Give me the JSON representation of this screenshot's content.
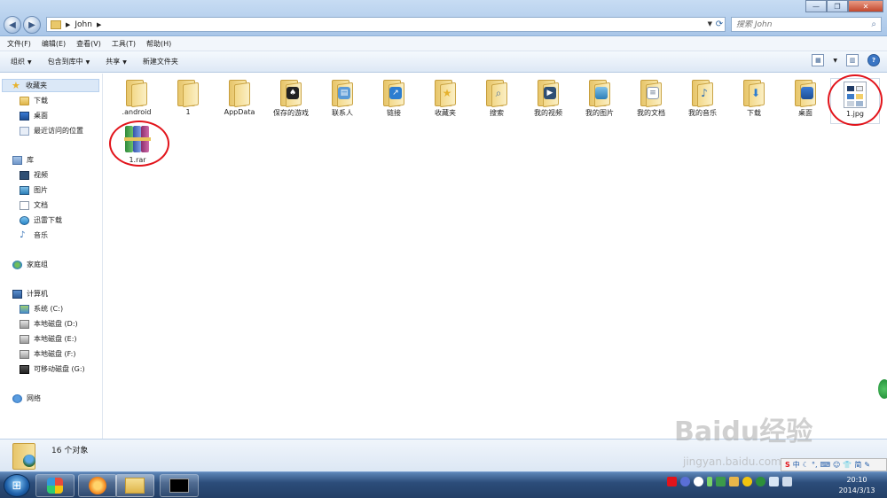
{
  "titlebar": {
    "breadcrumb": [
      "John"
    ],
    "search_placeholder": "搜索 John",
    "back_icon": "back-arrow-icon",
    "forward_icon": "forward-arrow-icon"
  },
  "menu": [
    "文件(F)",
    "编辑(E)",
    "查看(V)",
    "工具(T)",
    "帮助(H)"
  ],
  "toolbar": {
    "organize": "组织",
    "include_in_library": "包含到库中",
    "share": "共享",
    "new_folder": "新建文件夹"
  },
  "sidebar": {
    "favorites": {
      "label": "收藏夹",
      "items": [
        "下载",
        "桌面",
        "最近访问的位置"
      ]
    },
    "libraries": {
      "label": "库",
      "items": [
        "视频",
        "图片",
        "文档",
        "迅雷下载",
        "音乐"
      ]
    },
    "homegroup": "家庭组",
    "computer": {
      "label": "计算机",
      "items": [
        "系统 (C:)",
        "本地磁盘 (D:)",
        "本地磁盘 (E:)",
        "本地磁盘 (F:)",
        "可移动磁盘 (G:)"
      ]
    },
    "network": "网络"
  },
  "files": [
    {
      "name": ".android",
      "type": "folder"
    },
    {
      "name": "1",
      "type": "folder"
    },
    {
      "name": "AppData",
      "type": "folder"
    },
    {
      "name": "保存的游戏",
      "type": "folder"
    },
    {
      "name": "联系人",
      "type": "folder"
    },
    {
      "name": "链接",
      "type": "folder"
    },
    {
      "name": "收藏夹",
      "type": "folder"
    },
    {
      "name": "搜索",
      "type": "folder"
    },
    {
      "name": "我的视频",
      "type": "folder"
    },
    {
      "name": "我的图片",
      "type": "folder"
    },
    {
      "name": "我的文档",
      "type": "folder"
    },
    {
      "name": "我的音乐",
      "type": "folder"
    },
    {
      "name": "下载",
      "type": "folder"
    },
    {
      "name": "桌面",
      "type": "folder"
    },
    {
      "name": "1.jpg",
      "type": "image"
    },
    {
      "name": "1.rar",
      "type": "archive"
    }
  ],
  "details": {
    "count": "16 个对象"
  },
  "taskbar": {
    "clock_time": "20:10",
    "clock_date": "2014/3/13",
    "ime": [
      "中",
      "简"
    ]
  },
  "watermark": {
    "text": "Baidu经验",
    "sub": "jingyan.baidu.com"
  },
  "colors": {
    "highlight_circle": "#e2141b",
    "titlebar": "#c7dcf3",
    "taskbar": "#2c4d7a"
  }
}
